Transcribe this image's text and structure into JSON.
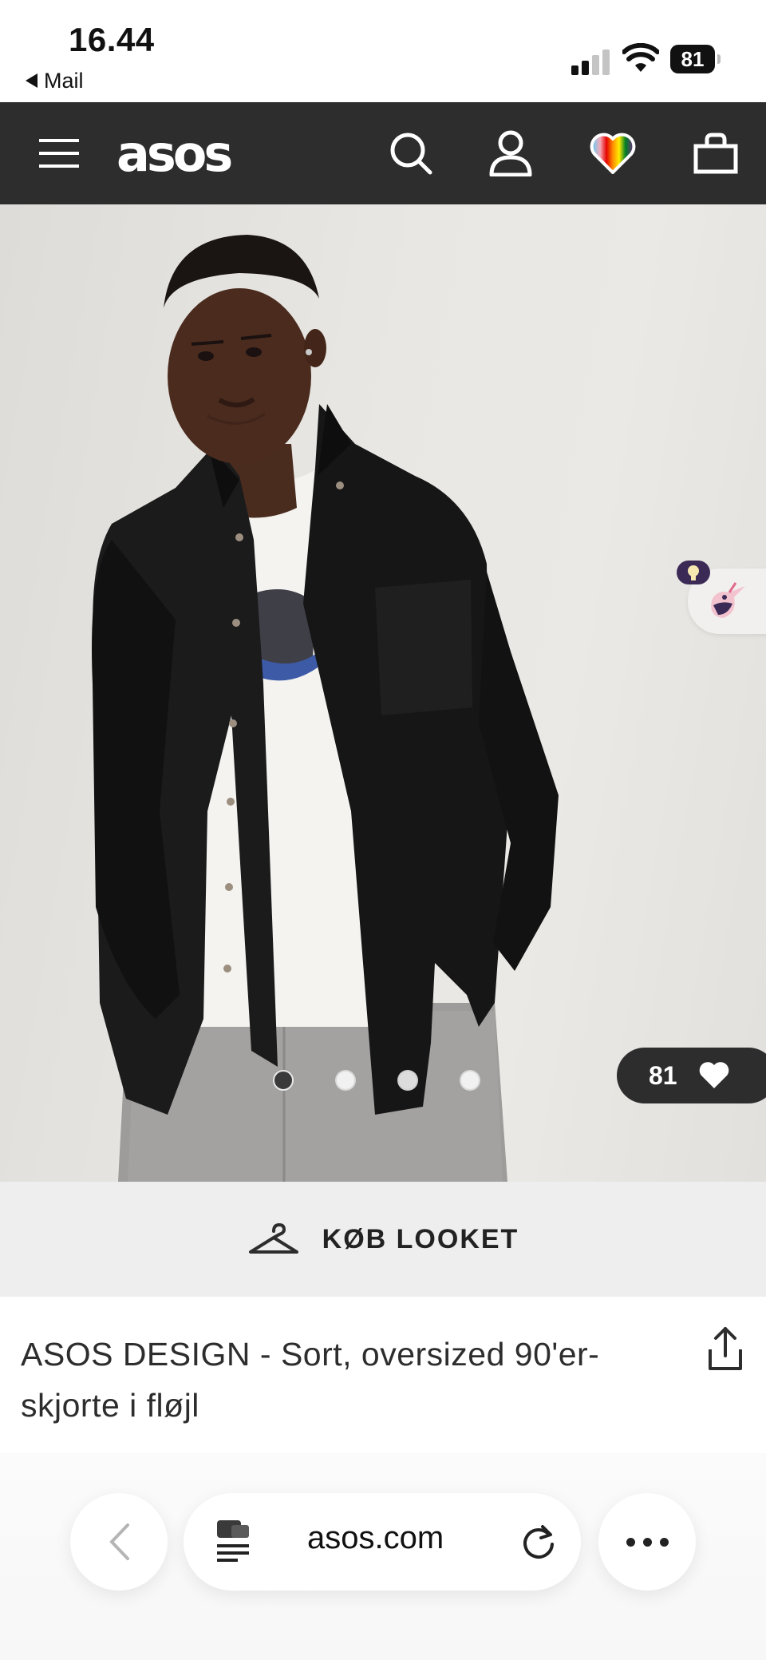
{
  "status_bar": {
    "time": "16.44",
    "back_app": "Mail",
    "battery": "81"
  },
  "nav": {
    "logo": "asos",
    "icons": [
      "menu-icon",
      "search-icon",
      "account-icon",
      "saved-heart-icon",
      "bag-icon"
    ]
  },
  "hero": {
    "image_dots_total": 4,
    "image_dots_active": 1,
    "like_count": "81"
  },
  "buy_look": {
    "label": "KØB LOOKET"
  },
  "product": {
    "title": "ASOS DESIGN - Sort, oversized 90'er-skjorte i fløjl"
  },
  "browser": {
    "url": "asos.com"
  },
  "colors": {
    "nav_bg": "#2d2d2d",
    "buy_look_bg": "#eeeeee",
    "text": "#2d2d2d"
  }
}
